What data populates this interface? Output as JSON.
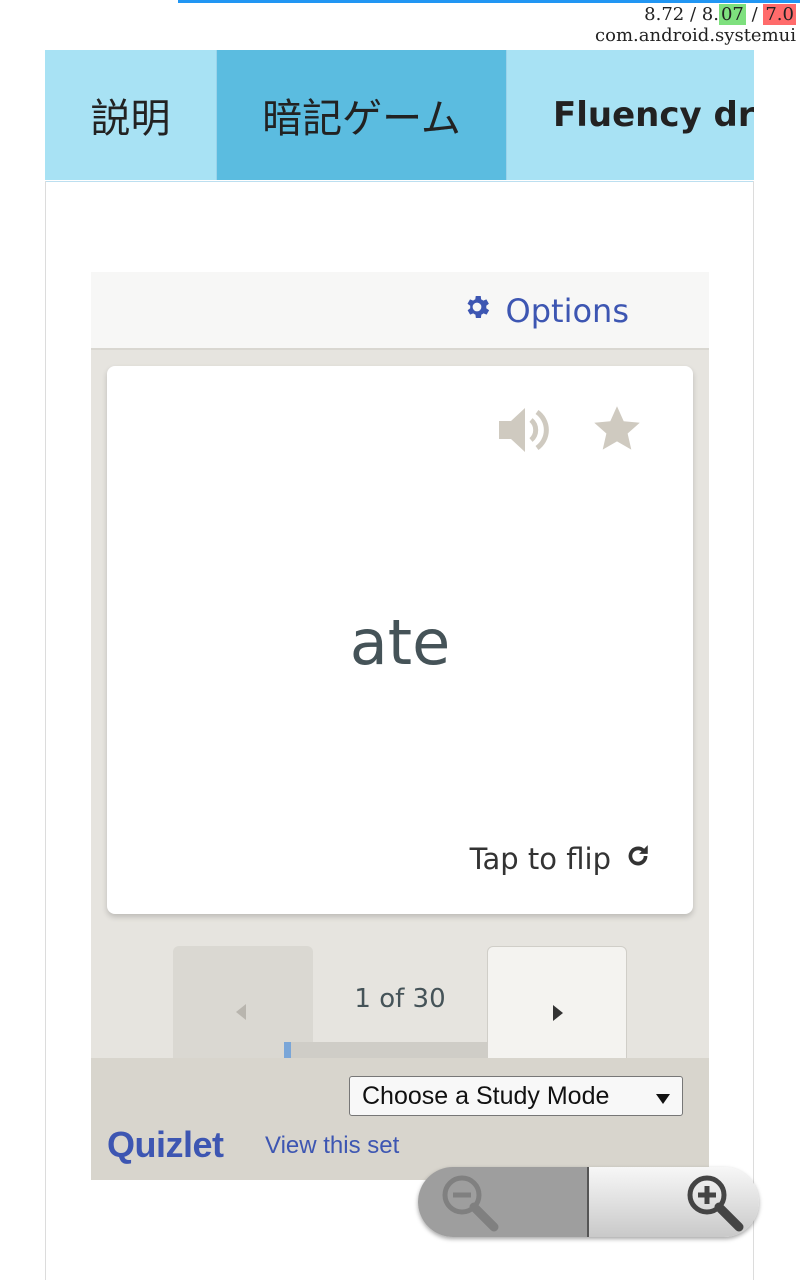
{
  "system": {
    "stats_prefix": "8.72 / 8.",
    "stats_green": "07",
    "stats_sep": " / ",
    "stats_red": "7.0",
    "package": "com.android.systemui"
  },
  "tabs": [
    {
      "label": "説明"
    },
    {
      "label": "暗記ゲーム"
    },
    {
      "label": "Fluency dri"
    }
  ],
  "embed": {
    "options_label": "Options",
    "card": {
      "term": "ate",
      "tap_to_flip": "Tap to flip"
    },
    "counter": "1 of 30",
    "progress": {
      "current": 1,
      "total": 30
    },
    "study_mode_select": "Choose a Study Mode",
    "logo": "Quizlet",
    "view_set": "View this set"
  },
  "colors": {
    "accent_blue": "#3d56b2",
    "tab_light": "#a8e2f4",
    "tab_active": "#5bbce0",
    "icon_grey": "#cfcac0"
  },
  "icons": [
    "gear-icon",
    "speaker-icon",
    "star-icon",
    "refresh-icon",
    "chevron-left-icon",
    "chevron-right-icon",
    "dropdown-arrow-icon",
    "zoom-out-icon",
    "zoom-in-icon"
  ]
}
